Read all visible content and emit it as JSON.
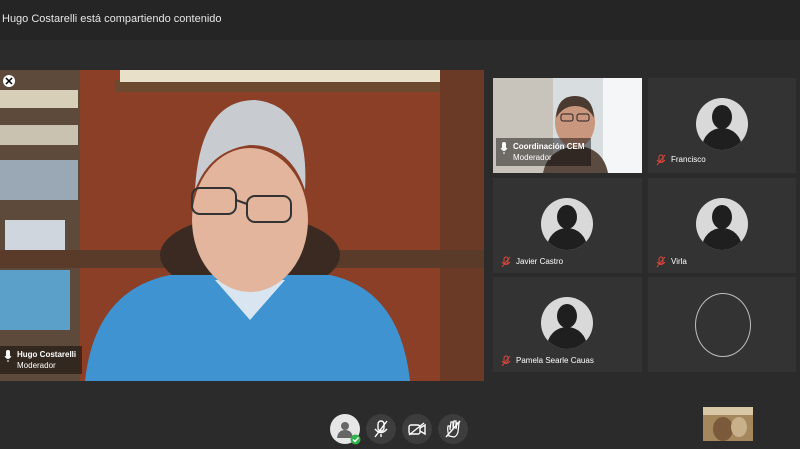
{
  "banner": {
    "text": "Hugo Costarelli está compartiendo contenido"
  },
  "main": {
    "name": "Hugo Costarelli",
    "role": "Moderador"
  },
  "participants": [
    {
      "name": "Coordinación CEM",
      "role": "Moderador",
      "muted": false,
      "has_video": true
    },
    {
      "name": "Francisco",
      "role": "",
      "muted": true,
      "has_video": false
    },
    {
      "name": "Javier Castro",
      "role": "",
      "muted": true,
      "has_video": false
    },
    {
      "name": "Virla",
      "role": "",
      "muted": true,
      "has_video": false
    },
    {
      "name": "Pamela Searle Cauas",
      "role": "",
      "muted": true,
      "has_video": false
    },
    {
      "name": "",
      "role": "",
      "muted": false,
      "has_video": false
    }
  ],
  "colors": {
    "muted_icon": "#e0473a",
    "background": "#2b2b2b",
    "tile": "#333333"
  },
  "controls": [
    "user-status-icon",
    "microphone-off-icon",
    "camera-off-icon",
    "raise-hand-off-icon"
  ]
}
